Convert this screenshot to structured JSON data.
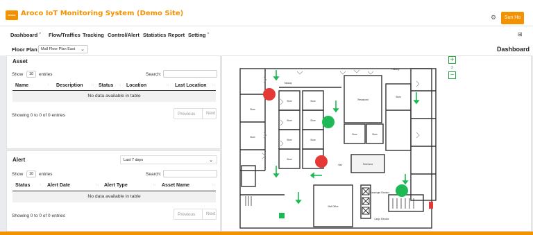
{
  "header": {
    "app_title": "Aroco IoT Monitoring System (Demo Site)",
    "logo_text": "aroco",
    "user_name": "Sun Ho"
  },
  "nav": {
    "items": [
      "Dashboard ˇ",
      "Flow/Traffics",
      "Tracking",
      "Control/Alert",
      "Statistics",
      "Report",
      "Setting ˇ"
    ]
  },
  "floorbar": {
    "label": "Floor Plan",
    "selected_floor": "Mall Floor Plan East",
    "page_name": "Dashboard"
  },
  "asset_panel": {
    "title": "Asset",
    "show": "Show",
    "entries_value": "10",
    "entries": "entries",
    "search_label": "Search:",
    "columns": [
      "Name",
      "Description",
      "Status",
      "Location",
      "Last Location"
    ],
    "empty_text": "No data available in table",
    "info": "Showing 0 to 0 of 0 entries",
    "prev": "Previous",
    "next": "Next"
  },
  "alert_panel": {
    "title": "Alert",
    "period": "Last 7 days",
    "show": "Show",
    "entries_value": "10",
    "entries": "entries",
    "search_label": "Search:",
    "columns": [
      "Status",
      "Alert Date",
      "Alert Type",
      "Asset Name"
    ],
    "empty_text": "No data available in table",
    "info": "Showing 0 to 0 of 0 entries",
    "prev": "Previous",
    "next": "Next"
  },
  "map": {
    "zoom_level": "2",
    "labels": {
      "hallway": "Hallway",
      "store": "Store",
      "restaurant": "Restaurant",
      "rest_area": "Rest Area",
      "hall": "Hall",
      "mall_office": "Mall Office",
      "passenger_elevator": "Passenger Elevator",
      "cargo_elevator": "Cargo Elevator"
    },
    "sensors": [
      {
        "status": "alert",
        "color": "#e53935"
      },
      {
        "status": "ok",
        "color": "#1db954"
      },
      {
        "status": "alert",
        "color": "#e53935"
      },
      {
        "status": "ok",
        "color": "#1db954"
      }
    ]
  },
  "colors": {
    "accent": "#f39200",
    "ok": "#1db954",
    "alert": "#e53935"
  }
}
